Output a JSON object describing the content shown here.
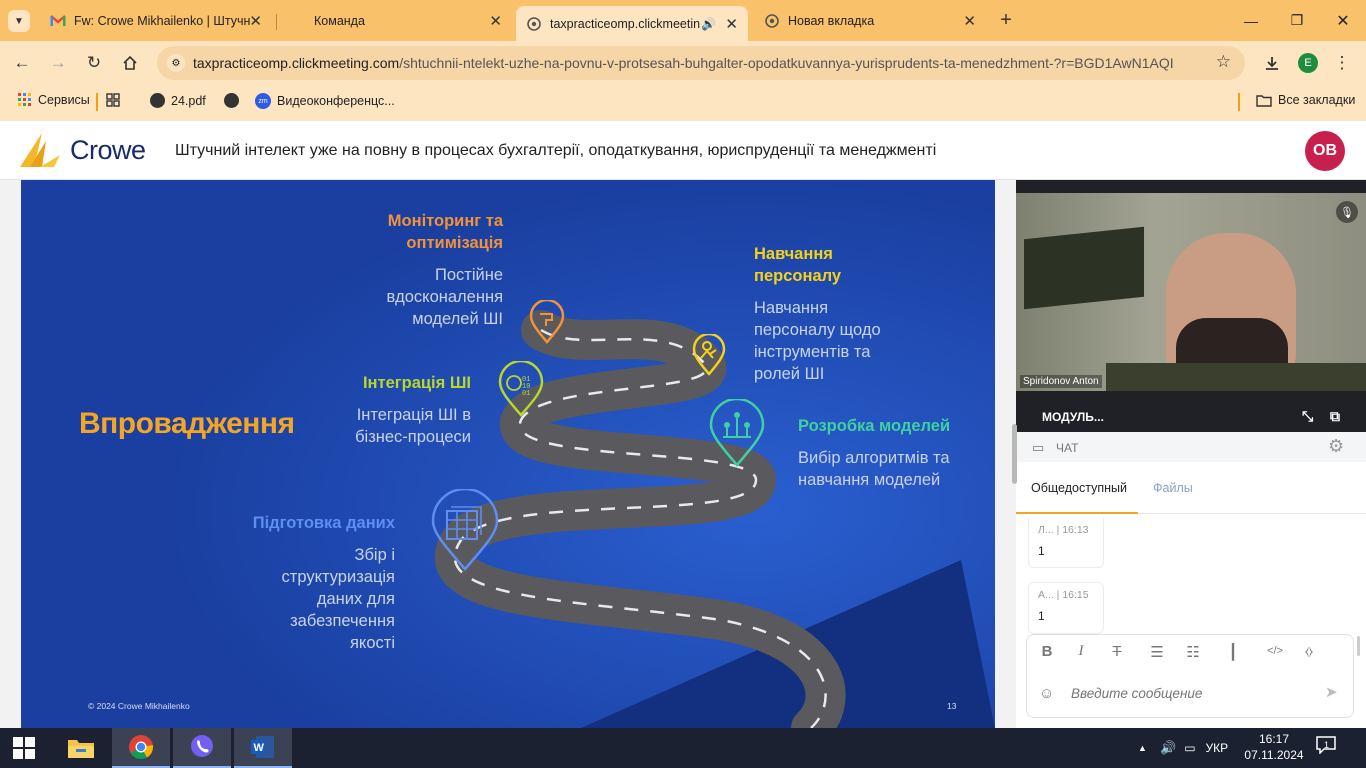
{
  "browser": {
    "tabs": [
      {
        "title": "Fw: Crowe Mikhailenko | Штучн",
        "icon": "gmail-icon"
      },
      {
        "title": "Команда",
        "icon": "none"
      },
      {
        "title": "taxpracticeomp.clickmeeting",
        "icon": "chrome-page-icon"
      },
      {
        "title": "Новая вкладка",
        "icon": "chrome-icon"
      }
    ],
    "url_domain": "taxpracticeomp.clickmeeting.com",
    "url_path": "/shtuchnii-ntelekt-uzhe-na-povnu-v-protsesah-buhgalter-opodatkuvannya-yurisprudents-ta-menedzhment-?r=BGD1AwN1AQI...",
    "profile_letter": "E",
    "bookmarks": [
      "Сервисы",
      "24.pdf",
      "Видеоконференцс..."
    ],
    "all_bookmarks": "Все закладки"
  },
  "app": {
    "brand": "Crowe",
    "title": "Штучний інтелект уже на повну в процесах бухгалтерії, оподаткування, юриспруденції та менеджменті",
    "avatar": "OB"
  },
  "slide": {
    "main_title": "Впровадження",
    "footer_copyright": "© 2024 Crowe Mikhailenko",
    "page_number": "13",
    "steps": [
      {
        "head_1": "Моніторинг та",
        "head_2": "оптимізація",
        "lines": [
          "Постійне",
          "вдосконалення",
          "моделей ШІ"
        ],
        "color": "#f2923a"
      },
      {
        "head_1": "Навчання",
        "head_2": "персоналу",
        "lines": [
          "Навчання",
          "персоналу щодо",
          "інструментів та",
          "ролей ШІ"
        ],
        "color": "#f5d21a"
      },
      {
        "head_1": "Інтеграція ШІ",
        "lines": [
          "Інтеграція ШІ в",
          "бізнес-процеси"
        ],
        "color": "#b8d62c"
      },
      {
        "head_1": "Розробка моделей",
        "lines": [
          "Вибір алгоритмів та",
          "навчання моделей"
        ],
        "color": "#3fd0a0"
      },
      {
        "head_1": "Підготовка даних",
        "lines": [
          "Збір і",
          "структуризація",
          "даних для",
          "забезпечення",
          "якості"
        ],
        "color": "#5d8ef0"
      }
    ]
  },
  "video": {
    "speaker": "Spiridonov Anton"
  },
  "panel": {
    "module_label": "МОДУЛЬ...",
    "chat_label": "ЧАТ",
    "tab_public": "Общедоступный",
    "tab_files": "Файлы",
    "messages": [
      {
        "author": "Л...",
        "time": "16:13",
        "text": "1"
      },
      {
        "author": "А...",
        "time": "16:15",
        "text": "1"
      }
    ],
    "input_placeholder": "Введите сообщение"
  },
  "taskbar": {
    "lang": "УКР",
    "time": "16:17",
    "date": "07.11.2024",
    "notif_count": "1"
  }
}
